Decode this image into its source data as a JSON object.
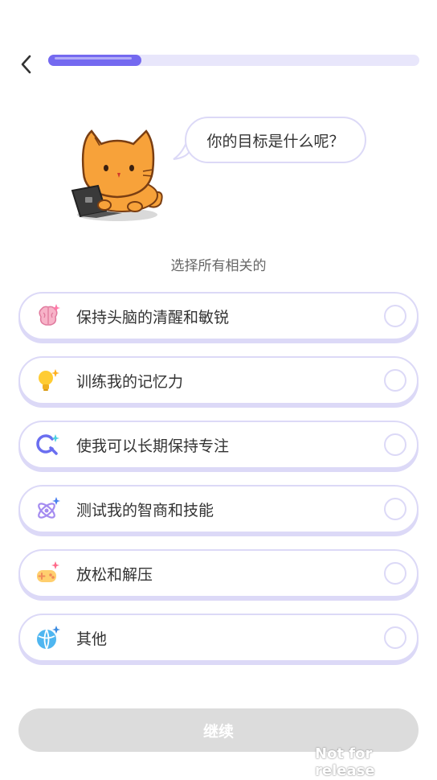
{
  "progress": {
    "value": 0.25,
    "color": "#7469f0",
    "track_color": "#e8e6fb"
  },
  "bubble": {
    "text": "你的目标是什么呢？"
  },
  "subtitle": "选择所有相关的",
  "options": [
    {
      "label": "保持头脑的清醒和敏锐",
      "icon": "brain-icon"
    },
    {
      "label": "训练我的记忆力",
      "icon": "lightbulb-icon"
    },
    {
      "label": "使我可以长期保持专注",
      "icon": "focus-search-icon"
    },
    {
      "label": "测试我的智商和技能",
      "icon": "atom-icon"
    },
    {
      "label": "放松和解压",
      "icon": "gamepad-icon"
    },
    {
      "label": "其他",
      "icon": "globe-icon"
    }
  ],
  "continue_label": "继续",
  "watermark": "Not for release",
  "colors": {
    "accent": "#7469f0",
    "border": "#dcd9f7",
    "disabled": "#dcdcdc",
    "mascot": "#f7a23a"
  }
}
